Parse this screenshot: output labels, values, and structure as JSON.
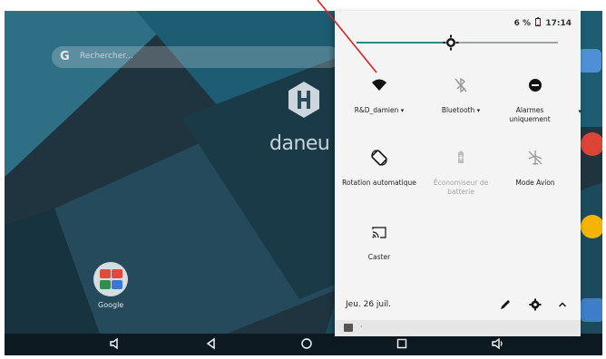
{
  "status": {
    "battery": "6 %",
    "time": "17:14"
  },
  "brightness": {
    "level": 0.47
  },
  "search": {
    "g": "G",
    "placeholder": "Rechercher..."
  },
  "logo": {
    "text": "daneu"
  },
  "home": {
    "folder_label": "Google"
  },
  "tiles": [
    {
      "label": "R&D_damien",
      "caret": "▾",
      "icon": "wifi-icon"
    },
    {
      "label": "Bluetooth",
      "caret": "▾",
      "icon": "bluetooth-off-icon"
    },
    {
      "label": "Alarmes uniquement",
      "caret": "▾",
      "icon": "do-not-disturb-icon"
    },
    {
      "label": "Rotation automatique",
      "icon": "auto-rotate-icon"
    },
    {
      "label": "Économiseur de batterie",
      "icon": "battery-saver-icon",
      "disabled": true
    },
    {
      "label": "Mode Avion",
      "icon": "airplane-off-icon"
    },
    {
      "label": "Caster",
      "icon": "cast-icon"
    }
  ],
  "date": {
    "label": "Jeu. 26 juil."
  },
  "footer": {
    "dot": "·"
  },
  "colors": {
    "accent": "#1f8f85",
    "shade_bg": "#f4f4f4",
    "wallpaper": "#1f3340"
  }
}
